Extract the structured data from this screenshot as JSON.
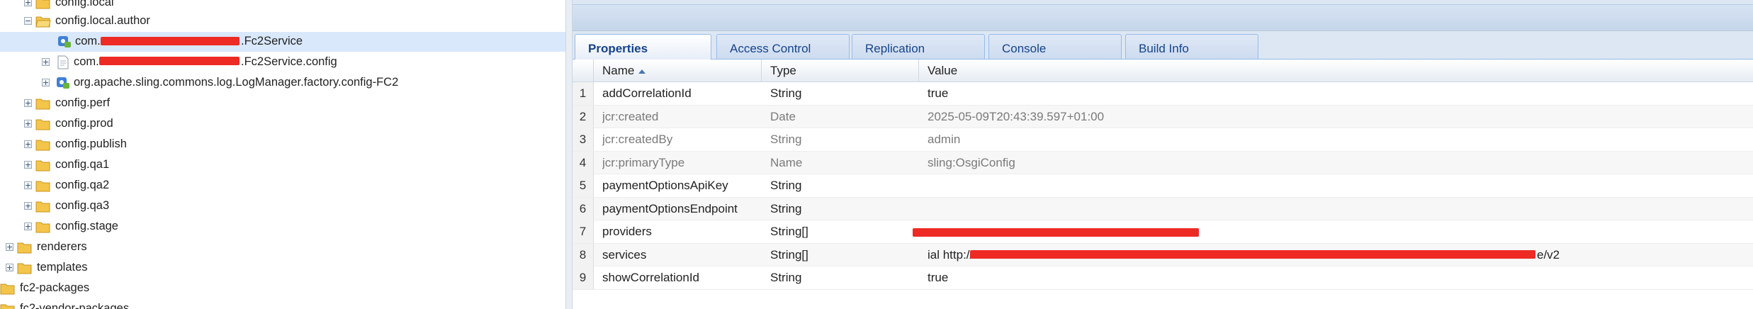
{
  "tree": {
    "items": [
      {
        "label": "config.local",
        "icon": "folder-icon",
        "expander": "+"
      },
      {
        "label": "config.local.author",
        "icon": "folder-open-icon",
        "expander": "−"
      },
      {
        "label_prefix": "com.",
        "label_suffix": ".Fc2Service",
        "icon": "osgi-config-icon",
        "expander": "",
        "selected": true
      },
      {
        "label_prefix": "com.",
        "label_suffix": ".Fc2Service.config",
        "icon": "file-icon",
        "expander": "+"
      },
      {
        "label": "org.apache.sling.commons.log.LogManager.factory.config-FC2",
        "icon": "osgi-config-icon",
        "expander": "+"
      },
      {
        "label": "config.perf",
        "icon": "folder-icon",
        "expander": "+"
      },
      {
        "label": "config.prod",
        "icon": "folder-icon",
        "expander": "+"
      },
      {
        "label": "config.publish",
        "icon": "folder-icon",
        "expander": "+"
      },
      {
        "label": "config.qa1",
        "icon": "folder-icon",
        "expander": "+"
      },
      {
        "label": "config.qa2",
        "icon": "folder-icon",
        "expander": "+"
      },
      {
        "label": "config.qa3",
        "icon": "folder-icon",
        "expander": "+"
      },
      {
        "label": "config.stage",
        "icon": "folder-icon",
        "expander": "+"
      },
      {
        "label": "renderers",
        "icon": "folder-icon",
        "expander": "+"
      },
      {
        "label": "templates",
        "icon": "folder-icon",
        "expander": "+"
      },
      {
        "label": "fc2-packages",
        "icon": "folder-icon",
        "expander": ""
      },
      {
        "label": "fc2-vendor-packages",
        "icon": "folder-icon",
        "expander": ""
      }
    ]
  },
  "tabs": [
    {
      "label": "Properties",
      "active": true
    },
    {
      "label": "Access Control",
      "active": false
    },
    {
      "label": "Replication",
      "active": false
    },
    {
      "label": "Console",
      "active": false
    },
    {
      "label": "Build Info",
      "active": false
    }
  ],
  "grid": {
    "columns": {
      "name": "Name",
      "type": "Type",
      "value": "Value"
    },
    "sort": "ascending",
    "rows": [
      {
        "num": "1",
        "name": "addCorrelationId",
        "type": "String",
        "value": "true",
        "muted": false
      },
      {
        "num": "2",
        "name": "jcr:created",
        "type": "Date",
        "value": "2025-05-09T20:43:39.597+01:00",
        "muted": true
      },
      {
        "num": "3",
        "name": "jcr:createdBy",
        "type": "String",
        "value": "admin",
        "muted": true
      },
      {
        "num": "4",
        "name": "jcr:primaryType",
        "type": "Name",
        "value": "sling:OsgiConfig",
        "muted": true
      },
      {
        "num": "5",
        "name": "paymentOptionsApiKey",
        "type": "String",
        "value": "",
        "muted": false
      },
      {
        "num": "6",
        "name": "paymentOptionsEndpoint",
        "type": "String",
        "value": "",
        "muted": false
      },
      {
        "num": "7",
        "name": "providers",
        "type": "String[]",
        "value": "",
        "muted": false
      },
      {
        "num": "8",
        "name": "services",
        "type": "String[]",
        "value_prefix": "ial http://",
        "value_suffix": "e/v2",
        "muted": false
      },
      {
        "num": "9",
        "name": "showCorrelationId",
        "type": "String",
        "value": "true",
        "muted": false
      }
    ]
  },
  "colors": {
    "redaction": "#ee2a24",
    "selected_row": "#d9e8fb",
    "tab_text": "#15428b",
    "folder": "#f3c54a"
  }
}
